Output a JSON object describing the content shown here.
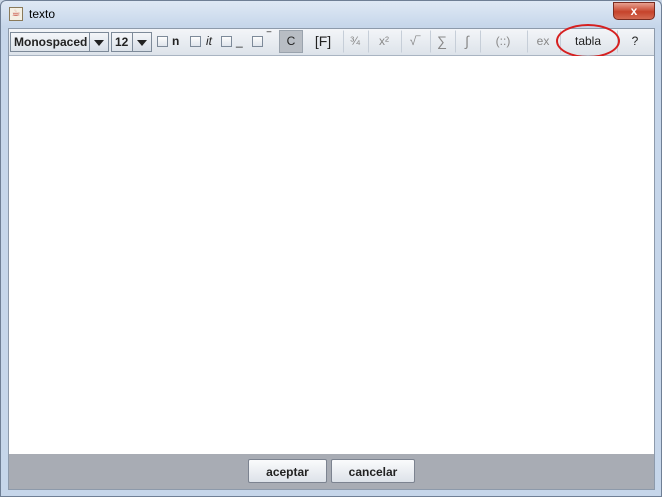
{
  "window": {
    "title": "texto",
    "close_label": "x"
  },
  "toolbar": {
    "font_family": "Monospaced",
    "font_size": "12",
    "checkboxes": [
      {
        "label": "n"
      },
      {
        "label": "it"
      },
      {
        "label": "_"
      },
      {
        "label": "‾"
      }
    ],
    "buttons": [
      {
        "label": "C"
      },
      {
        "label": "[F]"
      },
      {
        "label": "¾"
      },
      {
        "label": "x²"
      },
      {
        "label": "√‾"
      },
      {
        "label": "∑"
      },
      {
        "label": "∫"
      },
      {
        "label": "(::)"
      },
      {
        "label": "ex"
      },
      {
        "label": "tabla"
      },
      {
        "label": "?"
      }
    ]
  },
  "dialog": {
    "accept_label": "aceptar",
    "cancel_label": "cancelar"
  },
  "colors": {
    "highlight": "#d62020",
    "bottom_bar": "#a8acb4"
  }
}
